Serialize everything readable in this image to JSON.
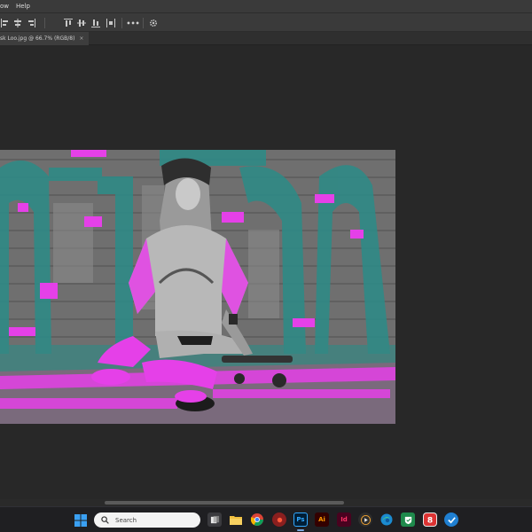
{
  "menubar": {
    "items": [
      "ow",
      "Help"
    ]
  },
  "optionsbar": {
    "more_label": "•••"
  },
  "document": {
    "tab_title": "sk Loo.jpg @ 66.7% (RGB/8)",
    "close_glyph": "×"
  },
  "taskbar": {
    "search_placeholder": "Search",
    "ps_label": "Ps",
    "ai_label": "Ai",
    "id_label": "Id"
  },
  "colors": {
    "magenta": "#e540e8",
    "teal": "#2f8a86",
    "gray": "#7d7d7d"
  }
}
